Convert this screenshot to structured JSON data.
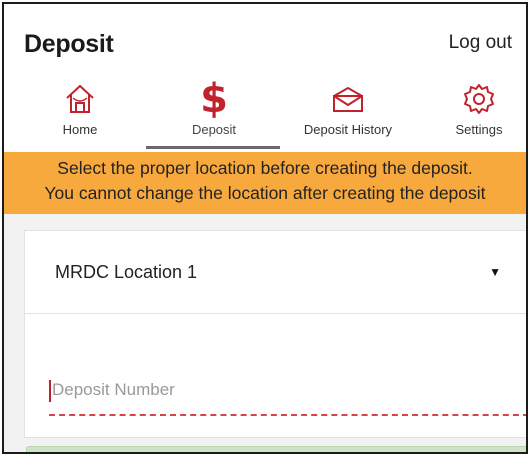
{
  "header": {
    "title": "Deposit",
    "logout_label": "Log out"
  },
  "nav": {
    "tabs": [
      {
        "label": "Home",
        "icon": "home-icon"
      },
      {
        "label": "Deposit",
        "icon": "dollar-icon",
        "glyph": "$",
        "active": true
      },
      {
        "label": "Deposit History",
        "icon": "envelope-icon"
      },
      {
        "label": "Settings",
        "icon": "gear-icon"
      }
    ]
  },
  "banner": {
    "line1": "Select the proper location before creating the deposit.",
    "line2": "You cannot change the location after creating the deposit",
    "color": "#f8a93e"
  },
  "form": {
    "location_value": "MRDC Location 1",
    "deposit_number_placeholder": "Deposit Number"
  },
  "colors": {
    "accent": "#c0232c",
    "banner": "#f8a93e",
    "button": "#cfe3c7"
  }
}
